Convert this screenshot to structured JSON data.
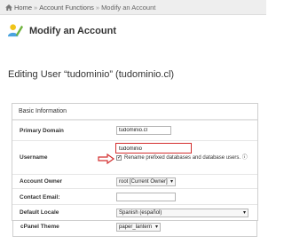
{
  "breadcrumb": {
    "home": "Home",
    "item1": "Account Functions",
    "item2": "Modify an Account",
    "separator": "»"
  },
  "page": {
    "title": "Modify an Account",
    "editing_title": "Editing User “tudominio” (tudominio.cl)"
  },
  "panel": {
    "heading": "Basic Information",
    "primary_domain": {
      "label": "Primary Domain",
      "value": "tudominio.cl"
    },
    "username": {
      "label": "Username",
      "value": "tudominio",
      "checkbox_checked": true,
      "checkbox_label": "Rename prefixed databases and database users."
    },
    "account_owner": {
      "label": "Account Owner",
      "value": "root [Current Owner]"
    },
    "contact_email": {
      "label": "Contact Email:",
      "value": ""
    },
    "default_locale": {
      "label": "Default Locale",
      "value": "Spanish (español)"
    },
    "cpanel_theme": {
      "label": "cPanel Theme",
      "value": "paper_lantern"
    }
  },
  "colors": {
    "highlight": "#d32f2f",
    "breadcrumb_bg": "#eeeeee"
  },
  "icons": {
    "home": "home-icon",
    "page": "user-edit-icon",
    "caret": "caret-down-icon",
    "info": "info-icon",
    "arrow": "arrow-right-icon"
  }
}
